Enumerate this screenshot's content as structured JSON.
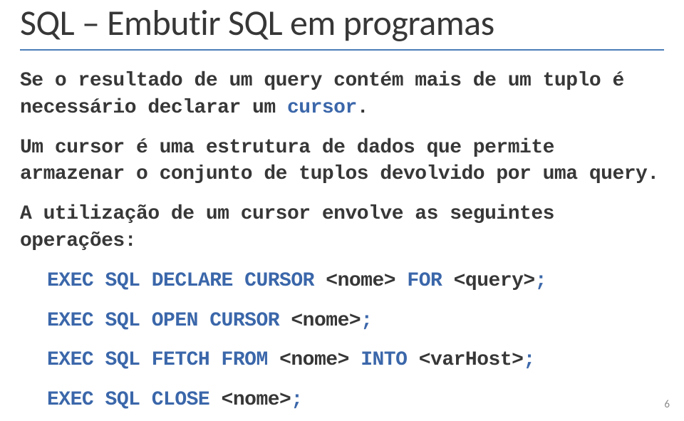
{
  "title": "SQL – Embutir SQL em programas",
  "p1_a": "Se o resultado de um query contém mais de um tuplo é necessário declarar um ",
  "p1_b": "cursor",
  "p1_c": ".",
  "p2": "Um cursor é uma estrutura de dados que permite armazenar o conjunto de tuplos devolvido por uma query.",
  "p3": "A utilização de um cursor envolve as seguintes operações:",
  "op1_a": "EXEC SQL DECLARE CURSOR ",
  "op1_b": "<nome>",
  "op1_c": " FOR ",
  "op1_d": "<query>",
  "op1_e": ";",
  "op2_a": "EXEC SQL OPEN CURSOR ",
  "op2_b": "<nome>",
  "op2_c": ";",
  "op3_a": "EXEC SQL FETCH FROM ",
  "op3_b": "<nome>",
  "op3_c": " INTO ",
  "op3_d": "<varHost>",
  "op3_e": ";",
  "op4_a": "EXEC SQL CLOSE ",
  "op4_b": "<nome>",
  "op4_c": ";",
  "page_number": "6"
}
